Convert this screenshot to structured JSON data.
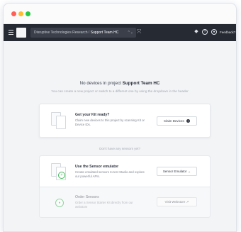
{
  "navbar": {
    "breadcrumb_org": "Disruptive Technologies Research",
    "breadcrumb_separator": " / ",
    "breadcrumb_project": "Support Team HC",
    "feedback_label": "Feedback?"
  },
  "empty_state": {
    "title_prefix": "No devices in project ",
    "title_project": "Support Team HC",
    "subtitle": "You can create a new project or switch to a different one by using the dropdown in the header"
  },
  "kit_card": {
    "title": "Got your Kit ready?",
    "description": "Claim new devices to this project by scanning Kit or Device IDs.",
    "button_label": "Claim Devices",
    "button_icon": "+"
  },
  "sensors_heading": "Don't have any sensors yet?",
  "emulator_card": {
    "title": "Use the Sensor emulator",
    "description": "Create emulated sensors to test Studio and explore our powerful APIs.",
    "button_label": "Sensor Emulator",
    "button_icon": "→"
  },
  "order_card": {
    "title": "Order Sensors",
    "description": "Order a Sensor Starter Kit directly from our webstore",
    "button_label": "Visit Webstore",
    "button_icon": "↗"
  },
  "colors": {
    "navbar": "#262a33",
    "accent_green": "#43b85c",
    "page_background": "#f3f4f6"
  }
}
